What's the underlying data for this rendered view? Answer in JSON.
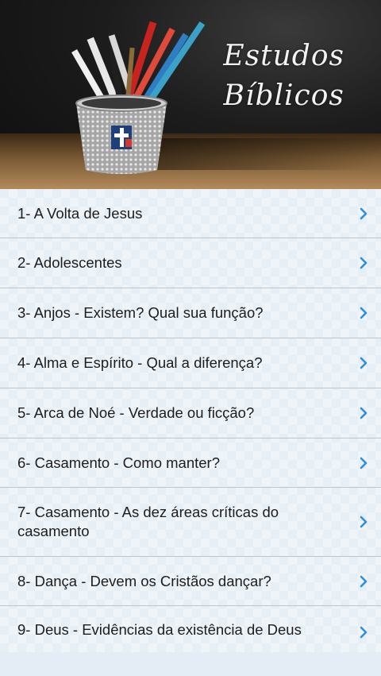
{
  "header": {
    "title_line1": "Estudos",
    "title_line2": "Bíblicos"
  },
  "list": {
    "items": [
      {
        "label": "1- A Volta de Jesus"
      },
      {
        "label": "2- Adolescentes"
      },
      {
        "label": "3- Anjos - Existem? Qual sua função?"
      },
      {
        "label": "4- Alma e Espírito - Qual a diferença?"
      },
      {
        "label": "5- Arca de Noé - Verdade ou ficção?"
      },
      {
        "label": "6- Casamento - Como manter?"
      },
      {
        "label": "7- Casamento - As dez áreas críticas do casamento"
      },
      {
        "label": "8- Dança - Devem os Cristãos dançar?"
      },
      {
        "label": "9- Deus - Evidências da existência de Deus"
      }
    ]
  },
  "colors": {
    "chevron": "#2f8fd8",
    "divider": "#b9c6d3",
    "list_background": "#e6eef6"
  }
}
